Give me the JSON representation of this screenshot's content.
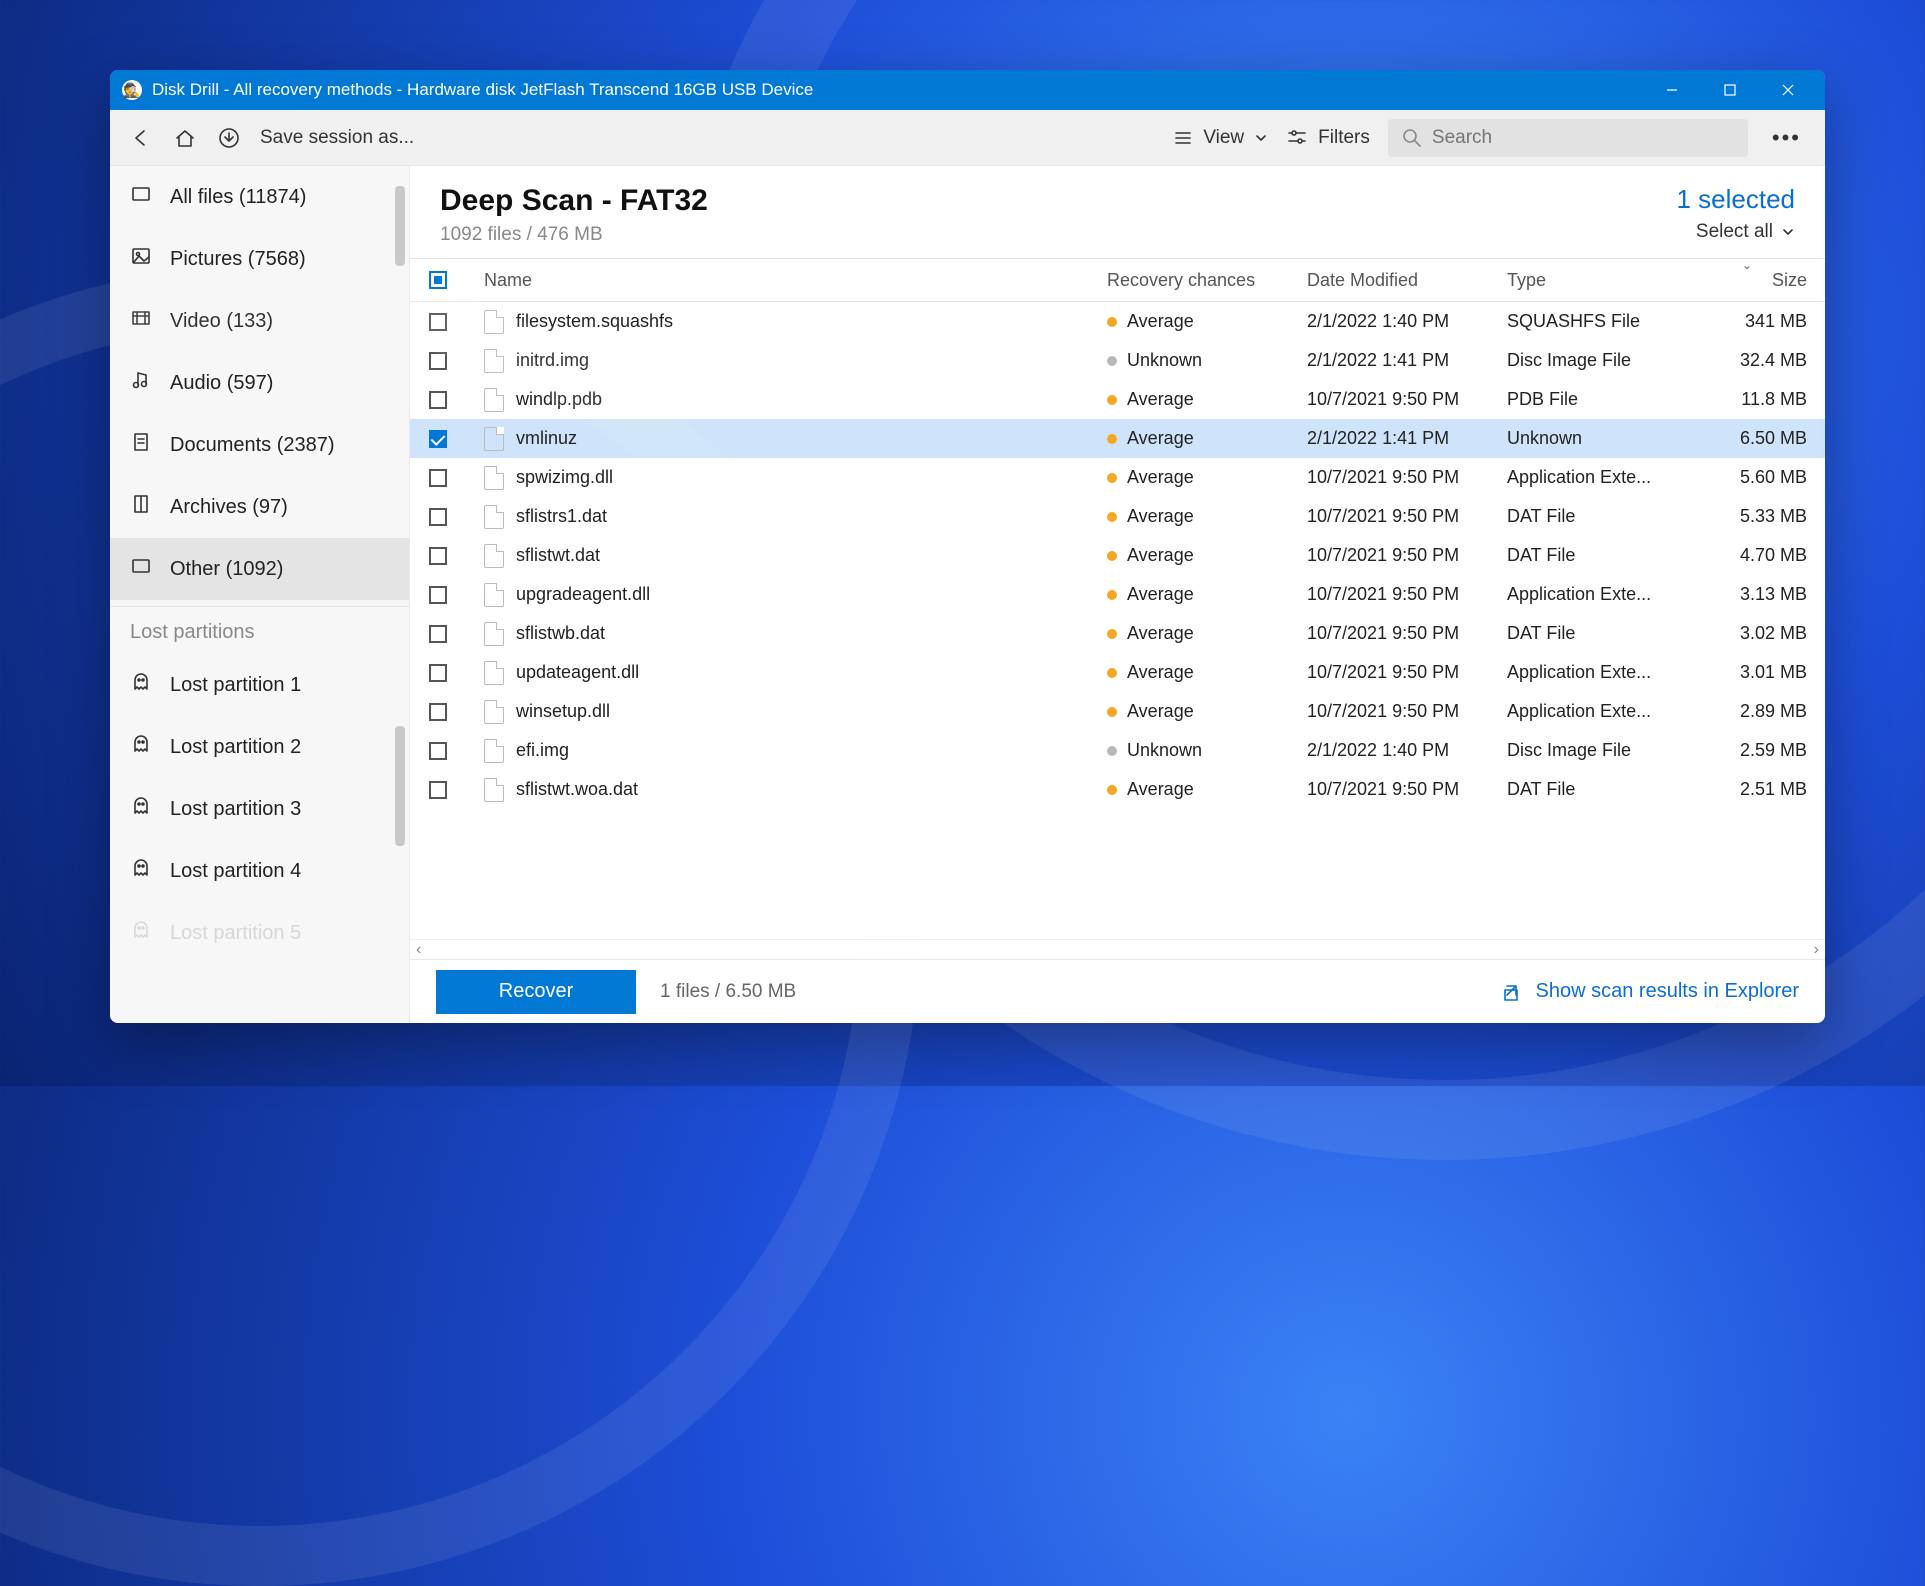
{
  "window": {
    "title": "Disk Drill - All recovery methods - Hardware disk JetFlash Transcend 16GB USB Device"
  },
  "toolbar": {
    "save_session": "Save session as...",
    "view_label": "View",
    "filters_label": "Filters",
    "search_placeholder": "Search"
  },
  "sidebar": {
    "items": [
      {
        "label": "All files (11874)",
        "icon": "all-files"
      },
      {
        "label": "Pictures (7568)",
        "icon": "pictures"
      },
      {
        "label": "Video (133)",
        "icon": "video"
      },
      {
        "label": "Audio (597)",
        "icon": "audio"
      },
      {
        "label": "Documents (2387)",
        "icon": "documents"
      },
      {
        "label": "Archives (97)",
        "icon": "archives"
      },
      {
        "label": "Other (1092)",
        "icon": "other",
        "active": true
      }
    ],
    "lost_header": "Lost partitions",
    "lost": [
      {
        "label": "Lost partition 1"
      },
      {
        "label": "Lost partition 2"
      },
      {
        "label": "Lost partition 3"
      },
      {
        "label": "Lost partition 4"
      },
      {
        "label": "Lost partition 5"
      }
    ]
  },
  "main": {
    "title": "Deep Scan - FAT32",
    "subtitle": "1092 files / 476 MB",
    "selected_label": "1 selected",
    "select_all": "Select all"
  },
  "columns": {
    "name": "Name",
    "recovery": "Recovery chances",
    "date": "Date Modified",
    "type": "Type",
    "size": "Size"
  },
  "rows": [
    {
      "name": "filesystem.squashfs",
      "chance": "Average",
      "dot": "avg",
      "date": "2/1/2022 1:40 PM",
      "type": "SQUASHFS File",
      "size": "341 MB",
      "checked": false
    },
    {
      "name": "initrd.img",
      "chance": "Unknown",
      "dot": "unk",
      "date": "2/1/2022 1:41 PM",
      "type": "Disc Image File",
      "size": "32.4 MB",
      "checked": false
    },
    {
      "name": "windlp.pdb",
      "chance": "Average",
      "dot": "avg",
      "date": "10/7/2021 9:50 PM",
      "type": "PDB File",
      "size": "11.8 MB",
      "checked": false
    },
    {
      "name": "vmlinuz",
      "chance": "Average",
      "dot": "avg",
      "date": "2/1/2022 1:41 PM",
      "type": "Unknown",
      "size": "6.50 MB",
      "checked": true
    },
    {
      "name": "spwizimg.dll",
      "chance": "Average",
      "dot": "avg",
      "date": "10/7/2021 9:50 PM",
      "type": "Application Exte...",
      "size": "5.60 MB",
      "checked": false
    },
    {
      "name": "sflistrs1.dat",
      "chance": "Average",
      "dot": "avg",
      "date": "10/7/2021 9:50 PM",
      "type": "DAT File",
      "size": "5.33 MB",
      "checked": false
    },
    {
      "name": "sflistwt.dat",
      "chance": "Average",
      "dot": "avg",
      "date": "10/7/2021 9:50 PM",
      "type": "DAT File",
      "size": "4.70 MB",
      "checked": false
    },
    {
      "name": "upgradeagent.dll",
      "chance": "Average",
      "dot": "avg",
      "date": "10/7/2021 9:50 PM",
      "type": "Application Exte...",
      "size": "3.13 MB",
      "checked": false
    },
    {
      "name": "sflistwb.dat",
      "chance": "Average",
      "dot": "avg",
      "date": "10/7/2021 9:50 PM",
      "type": "DAT File",
      "size": "3.02 MB",
      "checked": false
    },
    {
      "name": "updateagent.dll",
      "chance": "Average",
      "dot": "avg",
      "date": "10/7/2021 9:50 PM",
      "type": "Application Exte...",
      "size": "3.01 MB",
      "checked": false
    },
    {
      "name": "winsetup.dll",
      "chance": "Average",
      "dot": "avg",
      "date": "10/7/2021 9:50 PM",
      "type": "Application Exte...",
      "size": "2.89 MB",
      "checked": false
    },
    {
      "name": "efi.img",
      "chance": "Unknown",
      "dot": "unk",
      "date": "2/1/2022 1:40 PM",
      "type": "Disc Image File",
      "size": "2.59 MB",
      "checked": false
    },
    {
      "name": "sflistwt.woa.dat",
      "chance": "Average",
      "dot": "avg",
      "date": "10/7/2021 9:50 PM",
      "type": "DAT File",
      "size": "2.51 MB",
      "checked": false
    }
  ],
  "footer": {
    "recover": "Recover",
    "info": "1 files / 6.50 MB",
    "explorer_link": "Show scan results in Explorer"
  }
}
